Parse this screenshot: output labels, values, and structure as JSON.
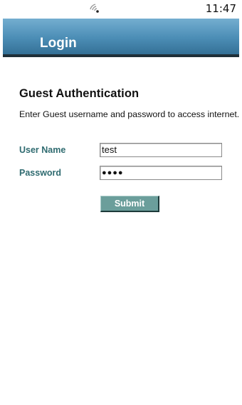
{
  "status_bar": {
    "time": "11:47",
    "signal_icon": "wifi-signal-icon"
  },
  "header": {
    "title": "Login",
    "gradient_top": "#74aed0",
    "gradient_bottom": "#347096",
    "border_color": "#1f2f38"
  },
  "main": {
    "title": "Guest Authentication",
    "description": "Enter Guest username and password to access internet."
  },
  "form": {
    "username": {
      "label": "User Name",
      "value": "test"
    },
    "password": {
      "label": "Password",
      "value": "●●●●"
    },
    "submit_label": "Submit",
    "label_color": "#2f6b70",
    "button_color": "#6b9e9b"
  }
}
